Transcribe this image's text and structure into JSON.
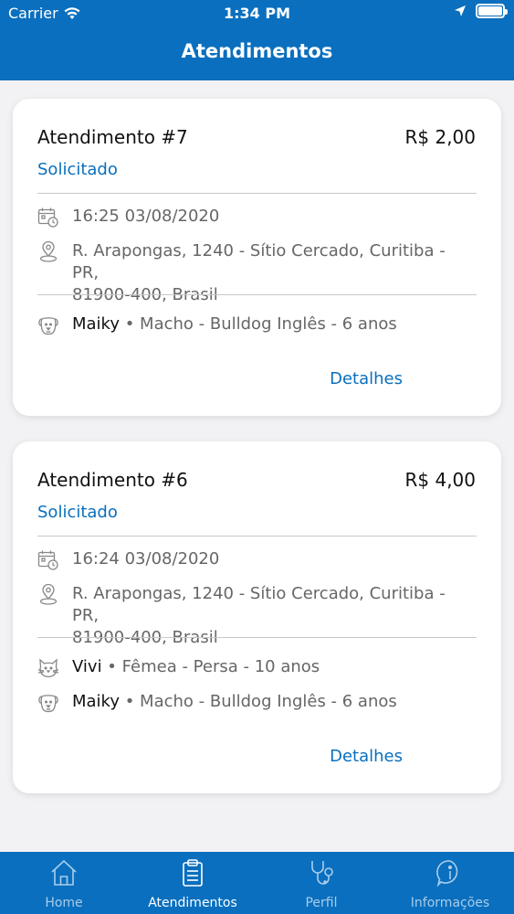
{
  "status_bar": {
    "carrier": "Carrier",
    "time": "1:34 PM"
  },
  "nav": {
    "title": "Atendimentos"
  },
  "cards": [
    {
      "title": "Atendimento #7",
      "price": "R$ 2,00",
      "status": "Solicitado",
      "datetime": "16:25 03/08/2020",
      "address_line1": "R. Arapongas, 1240 - Sítio Cercado, Curitiba - PR,",
      "address_line2": "81900-400, Brasil",
      "pets": [
        {
          "icon": "dog-icon",
          "name": "Maiky",
          "info": " • Macho - Bulldog Inglês - 6 anos"
        }
      ],
      "details_label": "Detalhes"
    },
    {
      "title": "Atendimento #6",
      "price": "R$ 4,00",
      "status": "Solicitado",
      "datetime": "16:24 03/08/2020",
      "address_line1": "R. Arapongas, 1240 - Sítio Cercado, Curitiba - PR,",
      "address_line2": "81900-400, Brasil",
      "pets": [
        {
          "icon": "cat-icon",
          "name": "Vivi",
          "info": " • Fêmea - Persa - 10 anos"
        },
        {
          "icon": "dog-icon",
          "name": "Maiky",
          "info": " • Macho - Bulldog Inglês - 6 anos"
        }
      ],
      "details_label": "Detalhes"
    }
  ],
  "tabbar": {
    "items": [
      {
        "label": "Home",
        "icon": "home-icon",
        "active": false
      },
      {
        "label": "Atendimentos",
        "icon": "clipboard-icon",
        "active": true
      },
      {
        "label": "Perfil",
        "icon": "stethoscope-icon",
        "active": false
      },
      {
        "label": "Informações",
        "icon": "info-icon",
        "active": false
      }
    ]
  },
  "colors": {
    "primary": "#0a6fbe",
    "background": "#f2f2f4",
    "inactive_tab": "#a9cdea"
  }
}
